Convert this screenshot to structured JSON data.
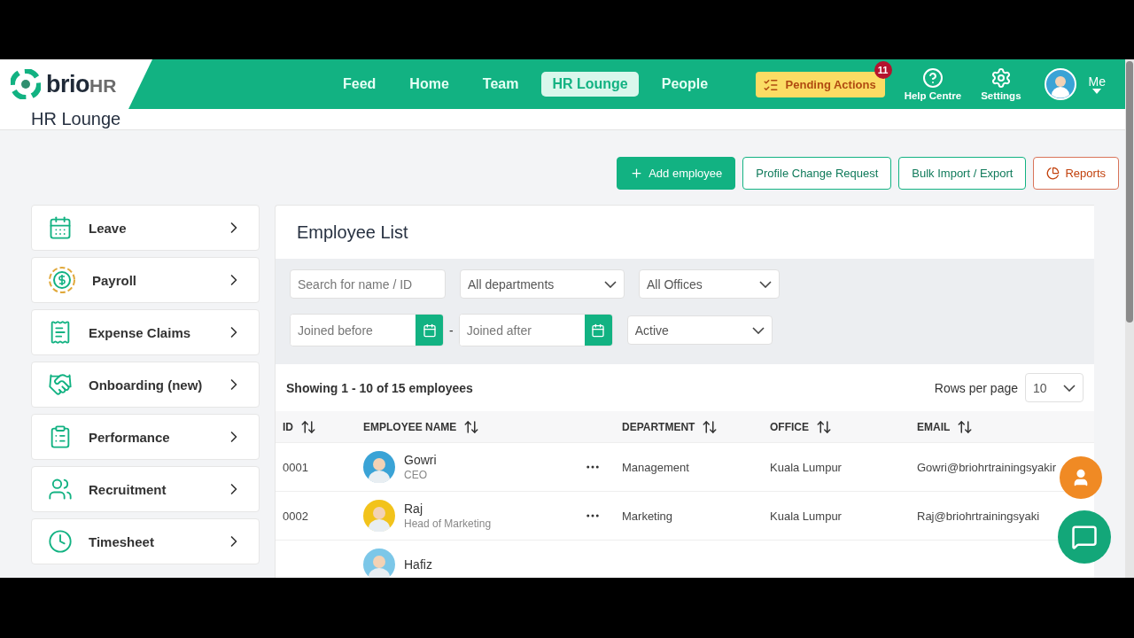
{
  "brand": {
    "name": "brio",
    "suffix": "HR"
  },
  "nav": [
    {
      "label": "Feed",
      "selected": false
    },
    {
      "label": "Home",
      "selected": false
    },
    {
      "label": "Team",
      "selected": false
    },
    {
      "label": "HR Lounge",
      "selected": true
    },
    {
      "label": "People",
      "selected": false
    }
  ],
  "pending": {
    "label": "Pending Actions",
    "count": "11"
  },
  "header_links": [
    {
      "label": "Help Centre",
      "kind": "help"
    },
    {
      "label": "Settings",
      "kind": "settings"
    }
  ],
  "user": {
    "label": "Me"
  },
  "page_title": "HR Lounge",
  "actions": [
    {
      "label": "Add employee",
      "kind": "primary"
    },
    {
      "label": "Profile Change Request",
      "kind": "outline"
    },
    {
      "label": "Bulk Import / Export",
      "kind": "outline"
    },
    {
      "label": "Reports",
      "kind": "danger"
    }
  ],
  "sidebar": [
    {
      "label": "Leave",
      "kind": "calendar"
    },
    {
      "label": "Payroll",
      "kind": "coin"
    },
    {
      "label": "Expense Claims",
      "kind": "receipt"
    },
    {
      "label": "Onboarding (new)",
      "kind": "handshake"
    },
    {
      "label": "Performance",
      "kind": "review"
    },
    {
      "label": "Recruitment",
      "kind": "people"
    },
    {
      "label": "Timesheet",
      "kind": "clock"
    }
  ],
  "panel_title": "Employee List",
  "filters": {
    "search": {
      "placeholder": "Search for name / ID"
    },
    "department": {
      "value": "All departments"
    },
    "office": {
      "value": "All Offices"
    },
    "joined_before": {
      "placeholder": "Joined before"
    },
    "separator": "-",
    "joined_after": {
      "placeholder": "Joined after"
    },
    "status": {
      "value": "Active"
    }
  },
  "summary": "Showing 1 - 10 of 15 employees",
  "rows_per_page": {
    "label": "Rows per page",
    "value": "10"
  },
  "table": {
    "columns": [
      "ID",
      "EMPLOYEE NAME",
      "DEPARTMENT",
      "OFFICE",
      "EMAIL"
    ],
    "rows": [
      {
        "id": "0001",
        "name": "Gowri",
        "role": "CEO",
        "color": "#3aa3d6",
        "department": "Management",
        "office": "Kuala Lumpur",
        "email": "Gowri@briohrtrainingsyakir"
      },
      {
        "id": "0002",
        "name": "Raj",
        "role": "Head of Marketing",
        "color": "#f2c31b",
        "department": "Marketing",
        "office": "Kuala Lumpur",
        "email": "Raj@briohrtrainingsyaki"
      },
      {
        "name": "Hafiz",
        "color": "#7cc7e8"
      }
    ]
  }
}
